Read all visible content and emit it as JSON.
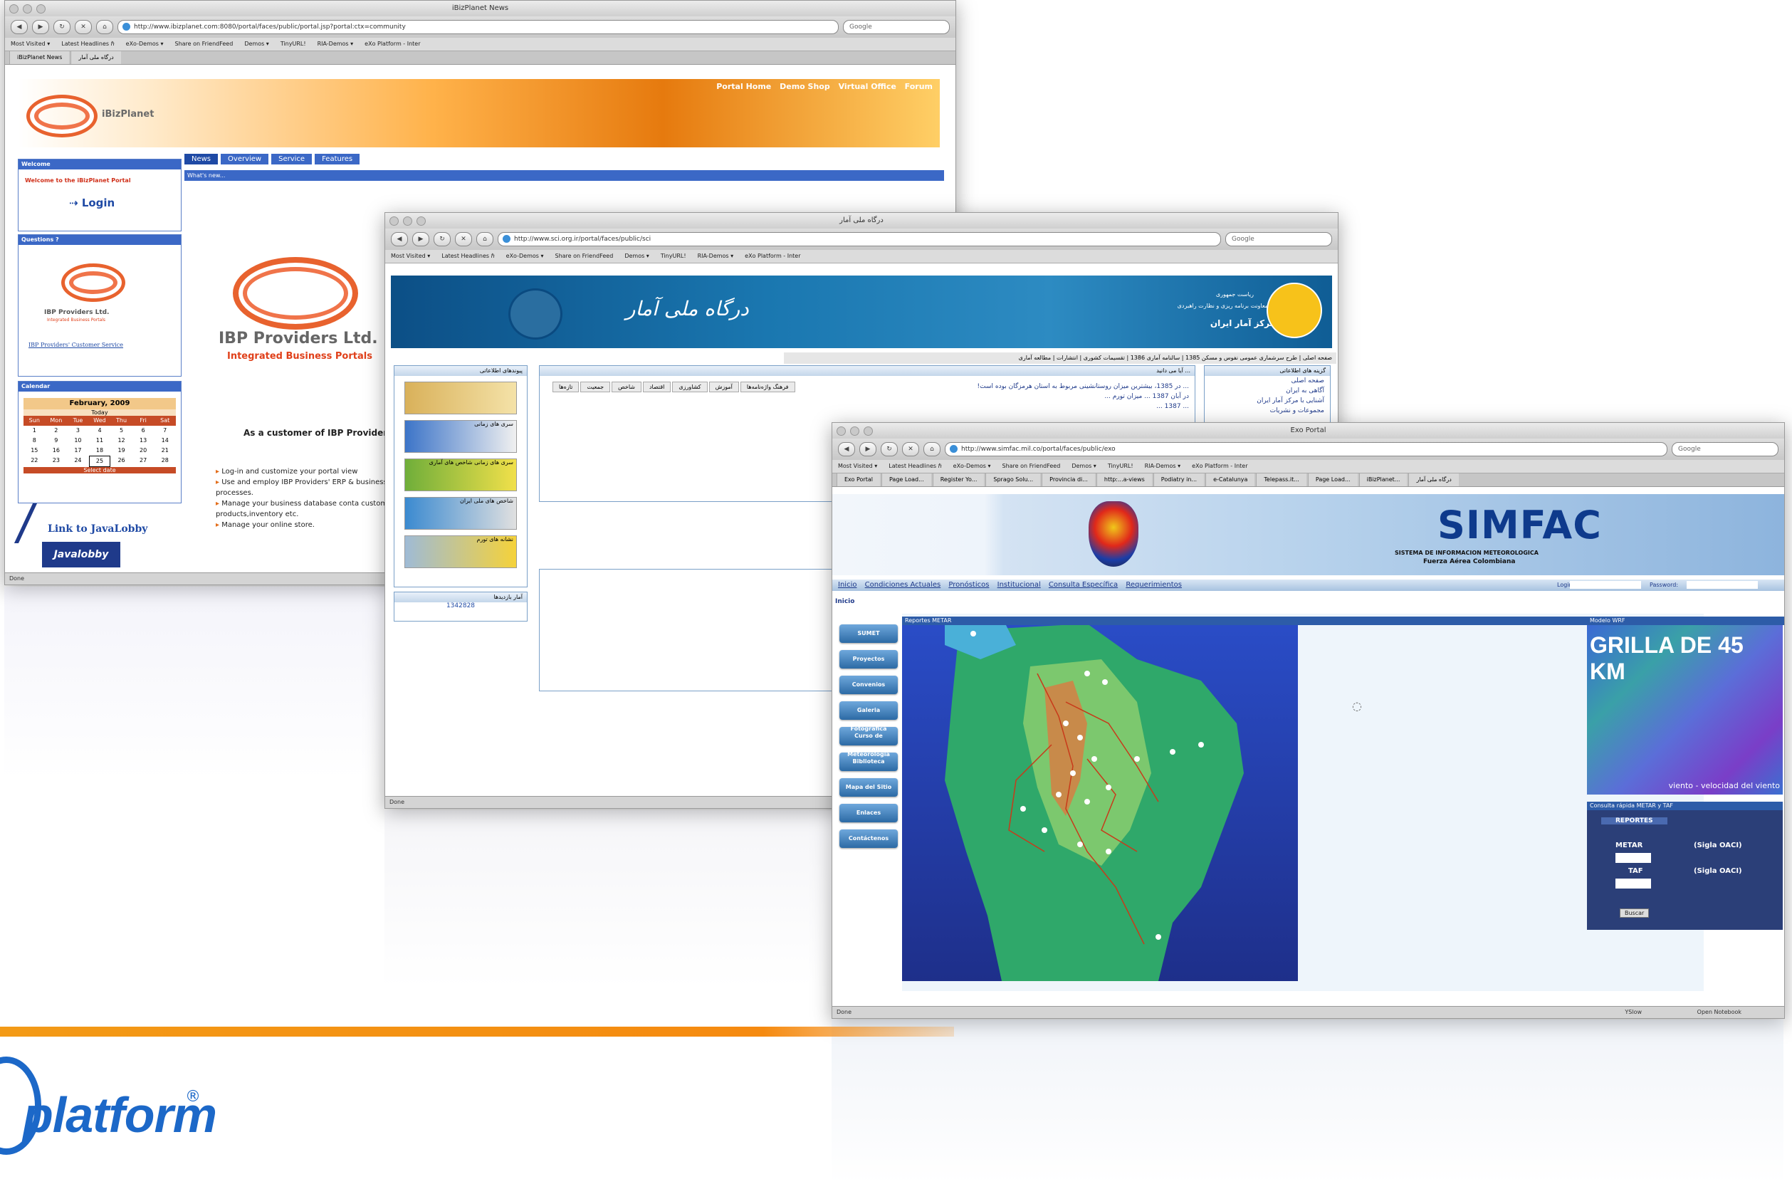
{
  "windows": [
    {
      "title": "iBizPlanet News",
      "url": "http://www.ibizplanet.com:8080/portal/faces/public/portal.jsp?portal:ctx=community",
      "search_placeholder": "Google",
      "bookmarks": [
        "Most Visited ▾",
        "Latest Headlines ℏ",
        "eXo-Demos ▾",
        "Share on FriendFeed",
        "Demos ▾",
        "TinyURL!",
        "RIA-Demos ▾",
        "eXo Platform - Inter"
      ],
      "tabs": [
        "iBizPlanet News",
        "درگاه ملی آمار"
      ],
      "status": "Done",
      "brand": "iBizPlanet",
      "top_menu": [
        "Portal Home",
        "Demo Shop",
        "Virtual Office",
        "Forum"
      ],
      "nav_tabs": [
        "News",
        "Overview",
        "Service",
        "Features"
      ],
      "whats_new": "What's new...",
      "portlets": {
        "welcome_title": "Welcome",
        "welcome_text": "Welcome to the iBizPlanet Portal",
        "login": "Login",
        "question_title": "Questions ?",
        "company_small": "IBP Providers Ltd.",
        "company_small_sub": "Integrated Business Portals",
        "customer_service": "IBP Providers' Customer Service",
        "calendar_title": "Calendar",
        "month": "February, 2009",
        "today": "Today",
        "select_date": "Select date",
        "weekdays": [
          "Sun",
          "Mon",
          "Tue",
          "Wed",
          "Thu",
          "Fri",
          "Sat"
        ],
        "days": [
          "1",
          "2",
          "3",
          "4",
          "5",
          "6",
          "7",
          "8",
          "9",
          "10",
          "11",
          "12",
          "13",
          "14",
          "15",
          "16",
          "17",
          "18",
          "19",
          "20",
          "21",
          "22",
          "23",
          "24",
          "25",
          "26",
          "27",
          "28"
        ],
        "java_link": "Link to JavaLobby",
        "java_logo": "Javalobby"
      },
      "company": "IBP Providers Ltd.",
      "company_sub": "Integrated Business Portals",
      "customer_heading": "As a customer of IBP Provider",
      "bullets": [
        "Log-in and customize your portal view",
        "Use and employ IBP Providers' ERP & business processes.",
        "Manage your business database conta customers, products,inventory etc.",
        "Manage your online store."
      ]
    },
    {
      "title": "درگاه ملی آمار",
      "url": "http://www.sci.org.ir/portal/faces/public/sci",
      "search_placeholder": "Google",
      "bookmarks": [
        "Most Visited ▾",
        "Latest Headlines ℏ",
        "eXo-Demos ▾",
        "Share on FriendFeed",
        "Demos ▾",
        "TinyURL!",
        "RIA-Demos ▾",
        "eXo Platform - Inter"
      ],
      "status": "Done",
      "banner_title": "درگاه ملی آمار",
      "org_line1": "ریاست جمهوری",
      "org_line2": "معاونت برنامه ریزی و نظارت راهبردی",
      "org_name": "مرکز آمار ایران",
      "menu": "صفحه اصلی | طرح سرشماری عمومی نفوس و مسکن 1385 | سالنامه آماری 1386 | تقسیمات کشوری | انتشارات | مطالعه آماری",
      "left_panel_title": "پیوندهای اطلاعاتی",
      "thumbs": [
        "",
        "سری های زمانی",
        "سری های زمانی شاخص های آماری",
        "شاخص های ملی ایران",
        "نشانه های تورم"
      ],
      "visitor_title": "آمار بازدیدها",
      "visitor_count": "1342828",
      "center_tabs": [
        "فرهنگ واژه‌نامه‌ها",
        "آموزش",
        "کشاورزی",
        "اقتصاد",
        "شاخص",
        "جمعیت",
        "تازه‌ها"
      ],
      "news_title": "آیا می دانید ...",
      "news": [
        "... در 1385، بیشترین میزان روستانشینی مربوط به استان هرمزگان بوده است!",
        "در آبان 1387 ... میزان تورم ...",
        "... 1387 ..."
      ],
      "right_panel_title": "گزینه های اطلاعاتی",
      "right_links": [
        "صفحه اصلی",
        "آگاهی به ایران",
        "آشنایی با مرکز آمار ایران",
        "مجموعات و نشریات"
      ]
    },
    {
      "title": "Exo Portal",
      "url": "http://www.simfac.mil.co/portal/faces/public/exo",
      "search_placeholder": "Google",
      "bookmarks": [
        "Most Visited ▾",
        "Latest Headlines ℏ",
        "eXo-Demos ▾",
        "Share on FriendFeed",
        "Demos ▾",
        "TinyURL!",
        "RIA-Demos ▾",
        "eXo Platform - Inter"
      ],
      "tabs": [
        "Exo Portal",
        "Page Load...",
        "Register Yo...",
        "Sprago Solu...",
        "Provincia di...",
        "http:...a-views",
        "Podiatry in...",
        "e-Catalunya",
        "Telepass.it...",
        "Page Load...",
        "iBizPlanet...",
        "درگاه ملی آمار"
      ],
      "status": "Done",
      "brand": "SIMFAC",
      "sub1": "SISTEMA DE INFORMACION METEOROLOGICA",
      "sub2": "Fuerza Aérea Colombiana",
      "menu": [
        "Inicio",
        "Condiciones Actuales",
        "Pronósticos",
        "Institucional",
        "Consulta Específica",
        "Requerimientos"
      ],
      "login_label": "Login:",
      "password_label": "Password:",
      "breadcrumb": "Inicio",
      "left_buttons": [
        "SUMET",
        "Proyectos",
        "Convenios",
        "Galeria Fotografica",
        "Curso de Meteorologia",
        "Biblioteca",
        "Mapa del Sitio",
        "Enlaces",
        "Contáctenos"
      ],
      "map_title": "Reportes METAR",
      "wrf_title": "Modelo WRF",
      "wrf_label": "GRILLA DE 45 KM",
      "wrf_caption": "viento - velocidad del viento",
      "consulta_title": "Consulta rápida METAR y TAF",
      "reportes": "REPORTES",
      "metar": "METAR",
      "taf": "TAF",
      "sigla": "(Sigla OACI)",
      "buscar": "Buscar",
      "status_right": [
        "YSlow",
        "Open Notebook"
      ]
    }
  ],
  "branding": {
    "word": "platform",
    "mark": "®"
  },
  "colors": {
    "orange": "#f58a10",
    "blue": "#1c68c8",
    "portal_blue": "#3b68c6"
  }
}
